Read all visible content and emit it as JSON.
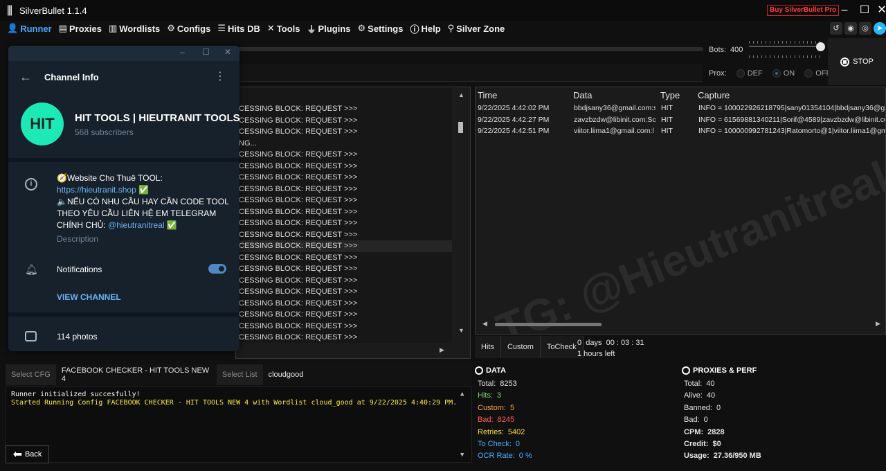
{
  "app": {
    "title": "SilverBullet 1.1.4",
    "buy_label": "Buy SilverBullet Pro"
  },
  "menu": [
    {
      "label": "Runner",
      "icon": "person-run-icon"
    },
    {
      "label": "Proxies",
      "icon": "server-icon"
    },
    {
      "label": "Wordlists",
      "icon": "books-icon"
    },
    {
      "label": "Configs",
      "icon": "gear-icon"
    },
    {
      "label": "Hits DB",
      "icon": "database-icon"
    },
    {
      "label": "Tools",
      "icon": "wrench-icon"
    },
    {
      "label": "Plugins",
      "icon": "plug-icon"
    },
    {
      "label": "Settings",
      "icon": "gear-icon"
    },
    {
      "label": "Help",
      "icon": "question-icon"
    },
    {
      "label": "Silver Zone",
      "icon": "pin-icon"
    }
  ],
  "runner": {
    "bots_label": "Bots:",
    "bots_value": "400",
    "proxies_label": "Prox:",
    "proxy_options": [
      "DEF",
      "ON",
      "OFF"
    ],
    "proxy_selected": "ON",
    "stop_label": "STOP"
  },
  "log": {
    "lines": [
      "CESSING BLOCK: REQUEST >>>",
      "CESSING BLOCK: REQUEST >>>",
      "CESSING BLOCK: REQUEST >>>",
      "NG...",
      "CESSING BLOCK: REQUEST >>>",
      "CESSING BLOCK: REQUEST >>>",
      "CESSING BLOCK: REQUEST >>>",
      "CESSING BLOCK: REQUEST >>>",
      "CESSING BLOCK: REQUEST >>>",
      "CESSING BLOCK: REQUEST >>>",
      "CESSING BLOCK: REQUEST >>>",
      "CESSING BLOCK: REQUEST >>>",
      "CESSING BLOCK: REQUEST >>>",
      "CESSING BLOCK: REQUEST >>>",
      "CESSING BLOCK: REQUEST >>>",
      "CESSING BLOCK: REQUEST >>>",
      "CESSING BLOCK: REQUEST >>>",
      "CESSING BLOCK: REQUEST >>>",
      "CESSING BLOCK: REQUEST >>>",
      "CESSING BLOCK: REQUEST >>>",
      "CESSING BLOCK: REQUEST >>>"
    ],
    "highlighted_index": 12
  },
  "hits": {
    "columns": [
      "Time",
      "Data",
      "Type",
      "Capture"
    ],
    "rows": [
      {
        "time": "9/22/2025 4:42:02 PM",
        "data": "bbdjsany36@gmail.com:s",
        "type": "HIT",
        "capture": "INFO = 100022926218795|sany01354104|bbdjsany36@gm"
      },
      {
        "time": "9/22/2025 4:42:27 PM",
        "data": "zavzbzdw@libinit.com:So",
        "type": "HIT",
        "capture": "INFO = 61569881340211|Sorif@4589|zavzbzdw@libinit.com"
      },
      {
        "time": "9/22/2025 4:42:51 PM",
        "data": "viitor.liima1@gmail.com:l",
        "type": "HIT",
        "capture": "INFO = 100000992781243|Ratomorto@1|viitor.liima1@gm"
      }
    ],
    "watermark": "TG: @Hieutranitreal"
  },
  "tabs": [
    "Hits",
    "Custom",
    "ToCheck"
  ],
  "timer": {
    "elapsed": "0  days  00 : 03 : 31",
    "left": "1 hours left"
  },
  "config": {
    "cfg_label": "Select CFG",
    "cfg_value": "FACEBOOK CHECKER - HIT TOOLS NEW 4",
    "list_label": "Select List",
    "list_value": "cloudgood"
  },
  "console": {
    "line1": "Runner initialized succesfully!",
    "line2": "Started Running Config FACEBOOK CHECKER - HIT TOOLS NEW 4 with Wordlist cloud_good at 9/22/2025 4:40:29 PM."
  },
  "back_label": "Back",
  "data_stats": {
    "title": "DATA",
    "total": {
      "label": "Total:",
      "value": "8253",
      "color": "#e6e6e6"
    },
    "hits": {
      "label": "Hits:",
      "value": "3",
      "color": "#7cd67c"
    },
    "custom": {
      "label": "Custom:",
      "value": "5",
      "color": "#ffa040"
    },
    "bad": {
      "label": "Bad:",
      "value": "8245",
      "color": "#ff5b5b"
    },
    "retries": {
      "label": "Retries:",
      "value": "5402",
      "color": "#ffd84a"
    },
    "tocheck": {
      "label": "To Check:",
      "value": "0",
      "color": "#4ab0ff"
    },
    "ocr": {
      "label": "OCR Rate:",
      "value": "0 %",
      "color": "#4ab0ff"
    }
  },
  "proxy_stats": {
    "title": "PROXIES & PERF",
    "total": {
      "label": "Total:",
      "value": "40"
    },
    "alive": {
      "label": "Alive:",
      "value": "40"
    },
    "banned": {
      "label": "Banned:",
      "value": "0"
    },
    "bad": {
      "label": "Bad:",
      "value": "0"
    },
    "cpm": {
      "label": "CPM:",
      "value": "2828"
    },
    "credit": {
      "label": "Credit:",
      "value": "$0"
    },
    "usage": {
      "label": "Usage:",
      "value": "27.36/950 MB"
    }
  },
  "telegram": {
    "header_title": "Channel Info",
    "avatar_text": "HIT",
    "channel_name": "HIT TOOLS | HIEUTRANIT TOOLS",
    "subscribers": "568 subscribers",
    "desc_line1": "🧭Website Cho Thuê TOOL:",
    "desc_link": "https://hieutranit.shop",
    "desc_check": "✅",
    "desc_line3": "🔈NẾU CÓ NHU CẦU HAY CẦN CODE TOOL THEO YÊU CẦU LIÊN HỆ EM TELEGRAM CHÍNH CHỦ:",
    "desc_handle": "@hieutranitreal",
    "desc_label": "Description",
    "notifications_label": "Notifications",
    "notifications_on": true,
    "view_channel": "VIEW CHANNEL",
    "photos": "114 photos"
  }
}
